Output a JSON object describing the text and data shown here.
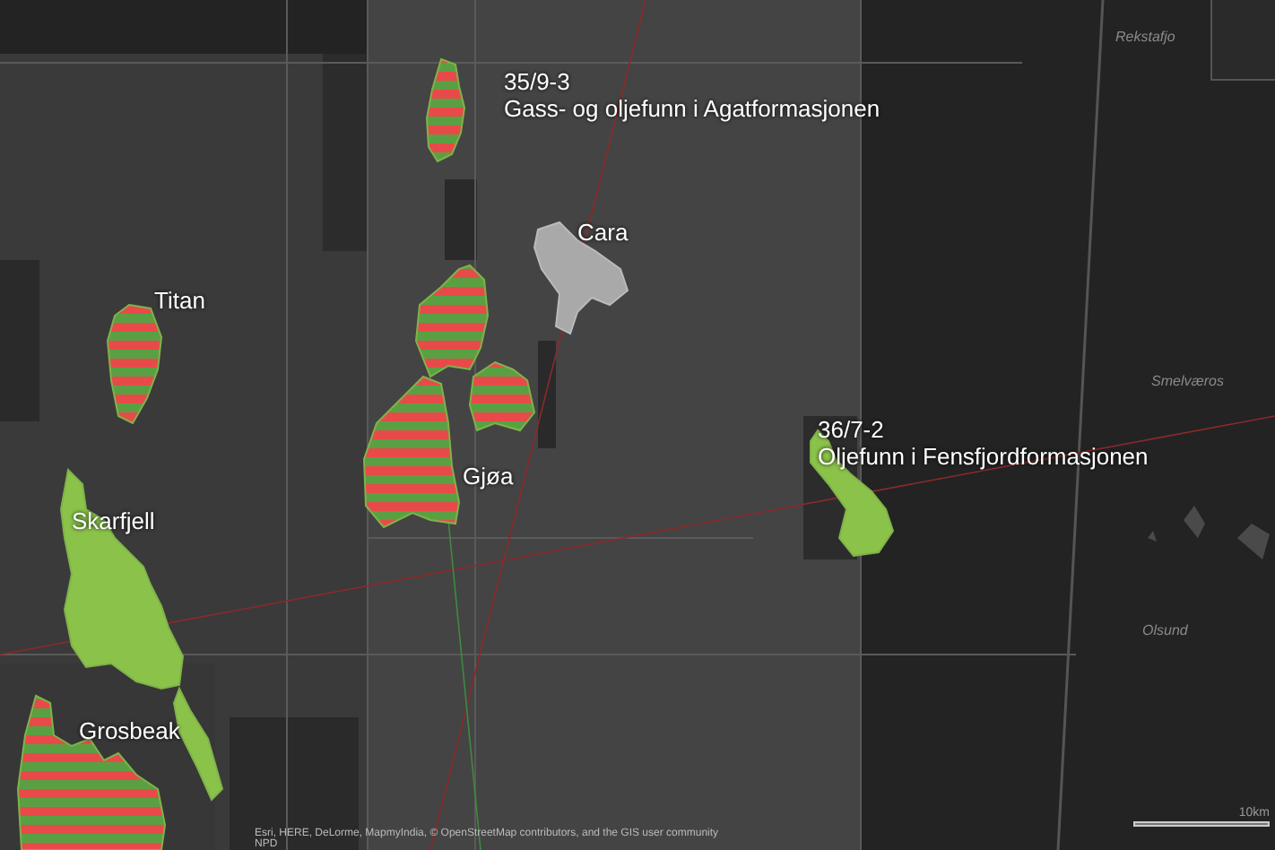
{
  "fields": [
    {
      "kind": "oil_gas",
      "label": "35/9-3",
      "description": "Gass- og oljefunn i Agatformasjonen"
    },
    {
      "kind": "other",
      "label": "Cara"
    },
    {
      "kind": "oil_gas",
      "label": "Titan"
    },
    {
      "kind": "oil_gas",
      "label": "Gjøa"
    },
    {
      "kind": "oil",
      "label": "36/7-2",
      "description": "Oljefunn i Fensfjordformasjonen"
    },
    {
      "kind": "oil",
      "label": "Skarfjell"
    },
    {
      "kind": "oil_gas",
      "label": "Grosbeak"
    }
  ],
  "places": [
    "Rekstafjo",
    "Smelværos",
    "Olsund"
  ],
  "attribution": [
    "Esri, HERE, DeLorme, MapmyIndia, © OpenStreetMap contributors, and the GIS user community",
    "NPD"
  ],
  "scale_bar": {
    "label": "10km"
  }
}
